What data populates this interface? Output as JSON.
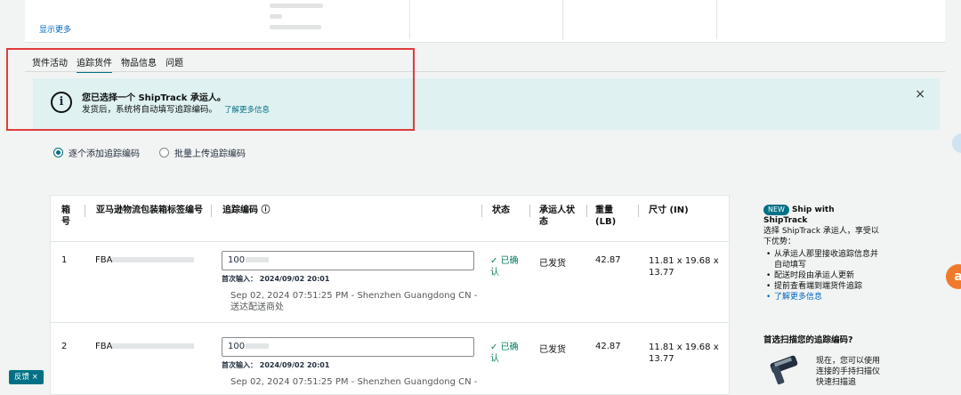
{
  "top_card": {
    "show_more": "显示更多"
  },
  "tabs": [
    {
      "label": "货件活动"
    },
    {
      "label": "追踪货件"
    },
    {
      "label": "物品信息"
    },
    {
      "label": "问题"
    }
  ],
  "banner": {
    "title": "您已选择一个 ShipTrack 承运人。",
    "text": "发货后，系统将自动填写追踪编码。",
    "link": "了解更多信息",
    "close": "×"
  },
  "radios": [
    {
      "label": "逐个添加追踪编码",
      "checked": true
    },
    {
      "label": "批量上传追踪编码",
      "checked": false
    }
  ],
  "table": {
    "headers": {
      "box_no": "箱号",
      "label": "亚马逊物流包装箱标签编号",
      "tracking": "追踪编码 ⓘ",
      "status": "状态",
      "carrier_status": "承运人状态",
      "weight": "重量(LB)",
      "size": "尺寸 (IN)"
    },
    "rows": [
      {
        "box": "1",
        "fba_prefix": "FBA",
        "tracking_prefix": "100",
        "first_input": "首次输入： 2024/09/02 20:01",
        "event_line1": "Sep 02, 2024 07:51:25 PM - Shenzhen Guangdong CN -",
        "event_line2": "送达配送商处",
        "status": "✓ 已确认",
        "carrier_status": "已发货",
        "weight": "42.87",
        "size": "11.81 x 19.68 x 13.77"
      },
      {
        "box": "2",
        "fba_prefix": "FBA",
        "tracking_prefix": "100",
        "first_input": "首次输入： 2024/09/02 20:01",
        "event_line1": "Sep 02, 2024 07:51:25 PM - Shenzhen Guangdong CN -",
        "event_line2": "",
        "status": "✓ 已确认",
        "carrier_status": "已发货",
        "weight": "42.87",
        "size": "11.81 x 19.68 x 13.77"
      }
    ]
  },
  "side": {
    "badge": "NEW",
    "title": "Ship with ShipTrack",
    "intro": "选择 ShipTrack 承运人，享受以下优势：",
    "items": [
      "从承运人那里接收追踪信息并自动填写",
      "配送时段由承运人更新",
      "提前查看端到端货件追踪"
    ],
    "link": "了解更多信息",
    "scan_title": "首选扫描您的追踪编码?",
    "scan_text": "现在，您可以使用连接的手持扫描仪快速扫描追"
  },
  "feedback": "反馈 ×",
  "orange_fab": "a",
  "colors": {
    "accent": "#007185",
    "highlight_border": "#e03b3b",
    "banner_bg": "#dff1f1"
  }
}
